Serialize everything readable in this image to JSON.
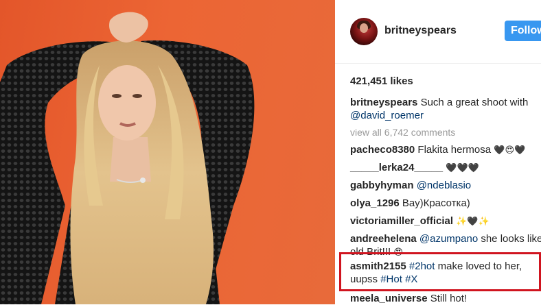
{
  "post": {
    "username": "britneyspears",
    "follow_label": "Follow",
    "likes": "421,451 likes",
    "caption": {
      "author": "britneyspears",
      "text": "Such a great shoot with",
      "mention": "@david_roemer"
    },
    "view_all": "view all 6,742 comments"
  },
  "comments": [
    {
      "user": "pacheco8380",
      "text": "Flakita hermosa",
      "emoji": "🖤😍🖤"
    },
    {
      "user": "_____lerka24_____",
      "text": "",
      "emoji": "🖤🖤🖤"
    },
    {
      "user": "gabbyhyman",
      "mention": "@ndeblasio"
    },
    {
      "user": "olya_1296",
      "text": "Вау)Красотка)"
    },
    {
      "user": "victoriamiller_official",
      "emoji": "✨🖤✨"
    },
    {
      "user": "andreehelena",
      "mention": "@azumpano",
      "text": "she looks like old Brit!!!",
      "emoji": "😍"
    },
    {
      "user": "asmith2155",
      "tag1": "#2hot",
      "text1": "make loved to her,",
      "text2": "uupss",
      "tag2": "#Hot",
      "tag3": "#X"
    },
    {
      "user": "meela_universe",
      "text": "Still hot!"
    }
  ],
  "colors": {
    "follow_button": "#3897f0",
    "highlight_border": "#d0141f",
    "link": "#003569",
    "background_photo": "#e8602f"
  }
}
